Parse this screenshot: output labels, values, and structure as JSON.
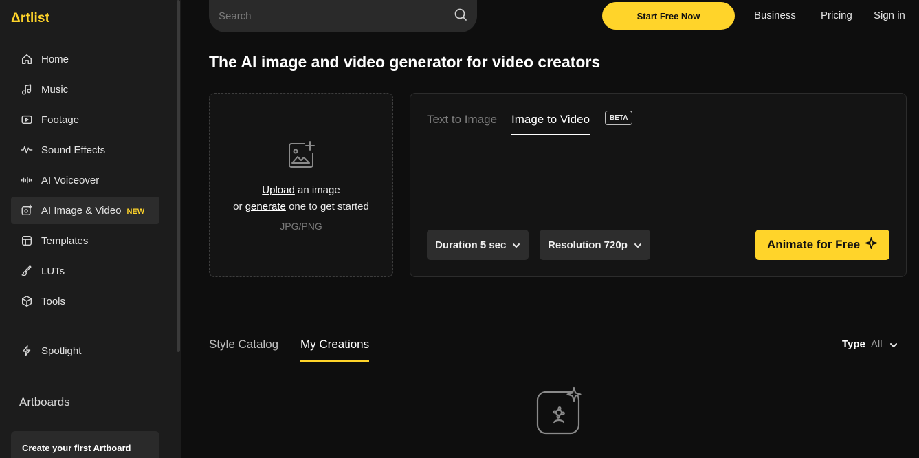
{
  "brand": {
    "logo_text": "Δrtlist",
    "accent_color": "#ffd42a"
  },
  "sidebar": {
    "items": [
      {
        "label": "Home",
        "icon": "home-icon"
      },
      {
        "label": "Music",
        "icon": "music-note-icon"
      },
      {
        "label": "Footage",
        "icon": "video-icon"
      },
      {
        "label": "Sound Effects",
        "icon": "waveform-icon"
      },
      {
        "label": "AI Voiceover",
        "icon": "audio-bars-icon"
      },
      {
        "label": "AI Image & Video",
        "icon": "ai-image-icon",
        "badge": "NEW",
        "active": true
      },
      {
        "label": "Templates",
        "icon": "template-icon"
      },
      {
        "label": "LUTs",
        "icon": "brush-icon"
      },
      {
        "label": "Tools",
        "icon": "cube-icon"
      }
    ],
    "spotlight": {
      "label": "Spotlight",
      "icon": "lightning-icon"
    },
    "artboards_title": "Artboards",
    "artboard_card": "Create your first Artboard"
  },
  "topbar": {
    "search_placeholder": "Search",
    "start_button": "Start Free Now",
    "links": [
      "Business",
      "Pricing",
      "Sign in"
    ]
  },
  "main": {
    "title": "The AI image and video generator for video creators",
    "upload": {
      "upload_link": "Upload",
      "line1_rest": " an image",
      "line2_prefix": "or ",
      "generate_link": "generate",
      "line2_rest": " one to get started",
      "formats": "JPG/PNG"
    },
    "generator": {
      "tabs": [
        "Text to Image",
        "Image to Video"
      ],
      "active_tab": "Image to Video",
      "beta_badge": "BETA",
      "duration_label": "Duration 5 sec",
      "resolution_label": "Resolution 720p",
      "animate_button": "Animate for Free"
    },
    "lower_tabs": [
      "Style Catalog",
      "My Creations"
    ],
    "active_lower_tab": "My Creations",
    "filter": {
      "label": "Type",
      "value": "All"
    }
  }
}
